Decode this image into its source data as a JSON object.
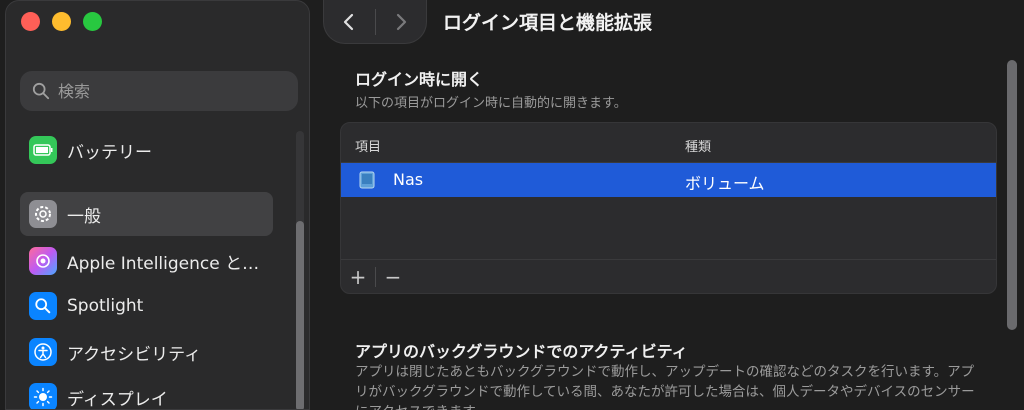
{
  "sidebar": {
    "search_placeholder": "検索",
    "items": [
      {
        "label": "バッテリー",
        "icon": "battery-icon",
        "color": "#34c759"
      },
      {
        "label": "一般",
        "icon": "gear-icon",
        "color": "#8e8e93",
        "selected": true
      },
      {
        "label": "Apple Intelligence と…",
        "icon": "apple-intelligence-icon",
        "color": "#bf5af2"
      },
      {
        "label": "Spotlight",
        "icon": "magnifier-icon",
        "color": "#0a84ff"
      },
      {
        "label": "アクセシビリティ",
        "icon": "accessibility-icon",
        "color": "#0a84ff"
      },
      {
        "label": "ディスプレイ",
        "icon": "sun-icon",
        "color": "#0a84ff"
      }
    ]
  },
  "header": {
    "title": "ログイン項目と機能拡張"
  },
  "login": {
    "title": "ログイン時に開く",
    "description": "以下の項目がログイン時に自動的に開きます。",
    "columns": [
      "項目",
      "種類"
    ],
    "rows": [
      {
        "name": "Nas",
        "kind": "ボリューム",
        "selected": true
      }
    ],
    "add_label": "+",
    "remove_label": "−"
  },
  "background": {
    "title": "アプリのバックグラウンドでのアクティビティ",
    "description": "アプリは閉じたあともバックグラウンドで動作し、アップデートの確認などのタスクを行います。アプリがバックグラウンドで動作している間、あなたが許可した場合は、個人データやデバイスのセンサーにアクセスできます。"
  },
  "colors": {
    "accent": "#1f5bd8",
    "selected_sidebar": "#414143"
  }
}
